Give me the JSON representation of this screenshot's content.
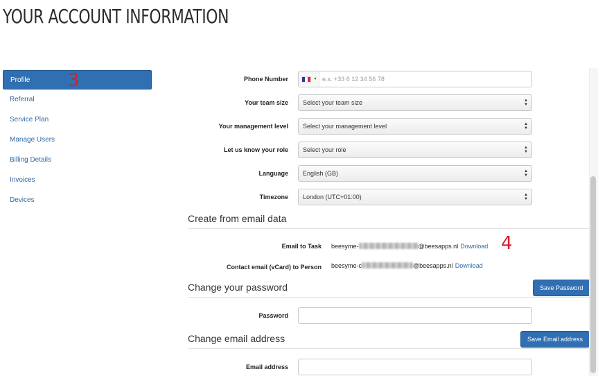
{
  "page": {
    "title": "YOUR ACCOUNT INFORMATION"
  },
  "sidebar": {
    "items": [
      {
        "label": "Profile",
        "active": true
      },
      {
        "label": "Referral"
      },
      {
        "label": "Service Plan"
      },
      {
        "label": "Manage Users"
      },
      {
        "label": "Billing Details"
      },
      {
        "label": "Invoices"
      },
      {
        "label": "Devices"
      }
    ]
  },
  "annotations": {
    "marker_3": "3",
    "marker_4": "4"
  },
  "profile": {
    "phone": {
      "label": "Phone Number",
      "placeholder": "e.x. +33 6 12 34 56 78",
      "country_icon": "france-flag-icon"
    },
    "team_size": {
      "label": "Your team size",
      "value": "Select your team size"
    },
    "management_level": {
      "label": "Your management level",
      "value": "Select your management level"
    },
    "role": {
      "label": "Let us know your role",
      "value": "Select your role"
    },
    "language": {
      "label": "Language",
      "value": "English (GB)"
    },
    "timezone": {
      "label": "Timezone",
      "value": "London (UTC+01:00)"
    }
  },
  "email_data": {
    "heading": "Create from email data",
    "task": {
      "label": "Email to Task",
      "prefix": "beesyme-",
      "suffix": "@beesapps.nl",
      "link": "Download"
    },
    "person": {
      "label": "Contact email (vCard) to Person",
      "prefix": "beesyme-c",
      "suffix": "@beesapps.nl",
      "link": "Download"
    }
  },
  "password": {
    "heading": "Change your password",
    "button": "Save Password",
    "label": "Password"
  },
  "email_change": {
    "heading": "Change email address",
    "button": "Save Email address",
    "label": "Email address"
  },
  "colors": {
    "accent": "#2f6fb2",
    "link": "#2f69a6",
    "annotation": "#d3202a"
  }
}
